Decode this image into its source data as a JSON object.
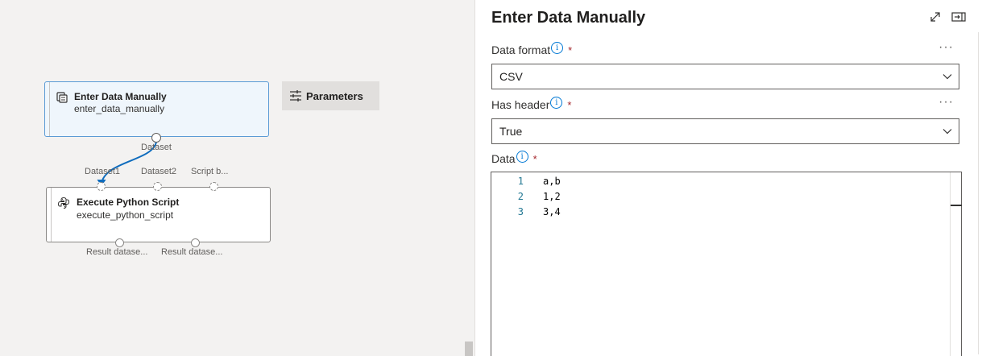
{
  "canvas": {
    "modules": {
      "enter_data": {
        "title": "Enter Data Manually",
        "subtitle": "enter_data_manually",
        "output_port_label": "Dataset"
      },
      "execute_python": {
        "title": "Execute Python Script",
        "subtitle": "execute_python_script",
        "input_port_labels": [
          "Dataset1",
          "Dataset2",
          "Script b..."
        ],
        "output_port_labels": [
          "Result datase...",
          "Result datase..."
        ]
      }
    },
    "parameters_button": {
      "label": "Parameters"
    }
  },
  "panel": {
    "title": "Enter Data Manually",
    "fields": {
      "data_format": {
        "label": "Data format",
        "required_mark": "*",
        "value": "CSV",
        "more": "···"
      },
      "has_header": {
        "label": "Has header",
        "required_mark": "*",
        "value": "True",
        "more": "···"
      },
      "data": {
        "label": "Data",
        "required_mark": "*",
        "lines": [
          {
            "num": "1",
            "text": "a,b"
          },
          {
            "num": "2",
            "text": "1,2"
          },
          {
            "num": "3",
            "text": "3,4"
          }
        ]
      }
    },
    "info_glyph": "i"
  },
  "icons": {
    "module": "dataset-module-icon",
    "python": "python-icon",
    "parameters": "sliders-icon",
    "expand": "expand-icon",
    "dock": "dock-right-icon",
    "chevron": "chevron-down-icon"
  },
  "colors": {
    "accent": "#0078d4",
    "connector": "#0f6cbd",
    "required": "#a4262c"
  }
}
